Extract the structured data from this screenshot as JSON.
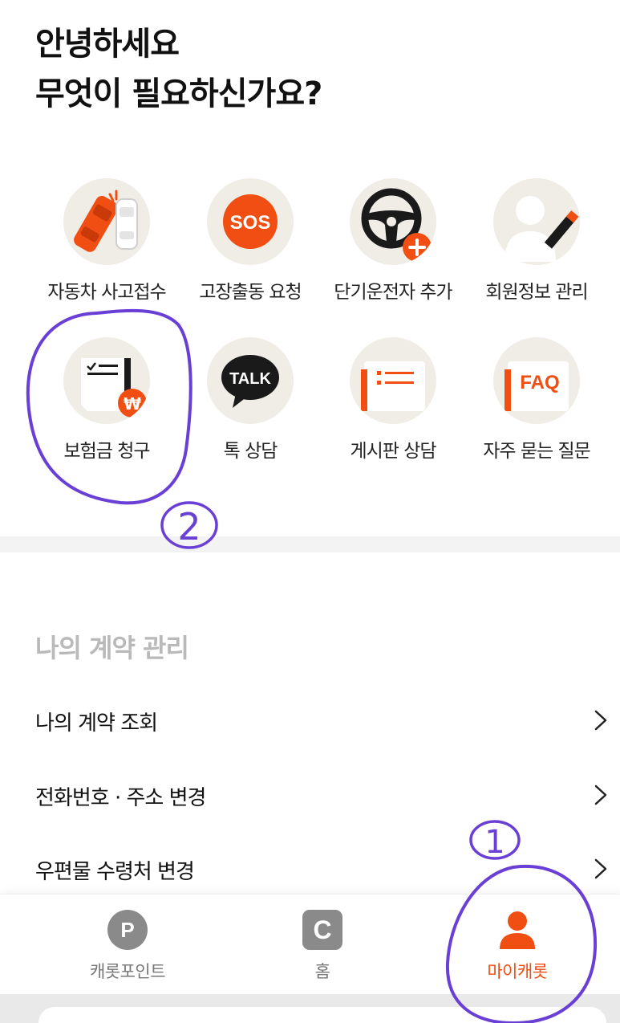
{
  "greeting": {
    "line1": "안녕하세요",
    "line2": "무엇이 필요하신가요?"
  },
  "quick_menu": [
    {
      "label": "자동차 사고접수",
      "icon": "car-accident-icon"
    },
    {
      "label": "고장출동 요청",
      "icon": "sos-icon"
    },
    {
      "label": "단기운전자 추가",
      "icon": "steering-wheel-add-icon"
    },
    {
      "label": "회원정보 관리",
      "icon": "profile-edit-icon"
    },
    {
      "label": "보험금 청구",
      "icon": "claim-document-icon"
    },
    {
      "label": "톡 상담",
      "icon": "talk-bubble-icon"
    },
    {
      "label": "게시판 상담",
      "icon": "board-list-icon"
    },
    {
      "label": "자주 묻는 질문",
      "icon": "faq-icon"
    }
  ],
  "icon_text": {
    "sos": "SOS",
    "talk": "TALK",
    "faq": "FAQ",
    "won": "₩"
  },
  "contract_section": {
    "title": "나의 계약 관리",
    "items": [
      {
        "label": "나의 계약 조회"
      },
      {
        "label": "전화번호 · 주소 변경"
      },
      {
        "label": "우편물 수령처 변경"
      }
    ]
  },
  "tabbar": {
    "tabs": [
      {
        "label": "캐롯포인트",
        "icon": "point-icon",
        "glyph": "P"
      },
      {
        "label": "홈",
        "icon": "home-c-icon",
        "glyph": "C"
      },
      {
        "label": "마이캐롯",
        "icon": "person-icon",
        "active": true
      }
    ]
  },
  "annotations": {
    "mark1": "1",
    "mark2": "2"
  },
  "colors": {
    "accent": "#f04e13",
    "icon_bg": "#f0ece6",
    "annotation": "#6a3fd6",
    "section_title": "#b9b9b9"
  }
}
